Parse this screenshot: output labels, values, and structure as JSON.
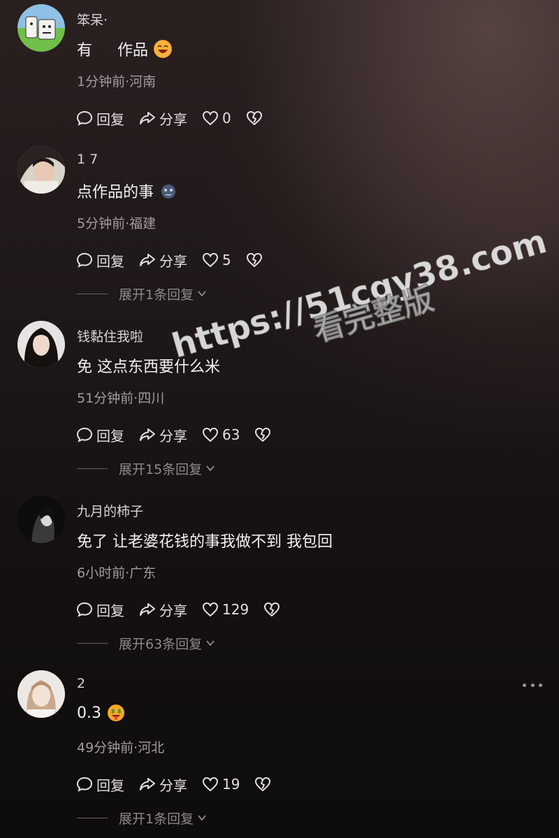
{
  "comments": [
    {
      "username": "笨呆·",
      "content": "有 　 作品",
      "emoji": "grinning-face-emoji",
      "meta": "1分钟前·河南",
      "reply_label": "回复",
      "share_label": "分享",
      "likes": "0"
    },
    {
      "username": "1 7",
      "content": "点作品的事",
      "emoji": "blue-blob-emoji",
      "meta": "5分钟前·福建",
      "reply_label": "回复",
      "share_label": "分享",
      "likes": "5",
      "expand_label": "展开1条回复"
    },
    {
      "username": "钱黏住我啦",
      "content": "免 这点东西要什么米",
      "meta": "51分钟前·四川",
      "reply_label": "回复",
      "share_label": "分享",
      "likes": "63",
      "expand_label": "展开15条回复"
    },
    {
      "username": "九月的柿子",
      "content": "免了 让老婆花钱的事我做不到 我包回",
      "meta": "6小时前·广东",
      "reply_label": "回复",
      "share_label": "分享",
      "likes": "129",
      "expand_label": "展开63条回复"
    },
    {
      "username": "2",
      "content": "0.3",
      "emoji": "money-face-emoji",
      "meta": "49分钟前·河北",
      "reply_label": "回复",
      "share_label": "分享",
      "likes": "19",
      "expand_label": "展开1条回复"
    }
  ],
  "watermark": {
    "url": "https://51cgy38.com",
    "subtitle": "看完整版"
  },
  "colors": {
    "text_primary": "#f2f0f0",
    "text_secondary": "#a39c9c",
    "background_dark": "#141010"
  }
}
